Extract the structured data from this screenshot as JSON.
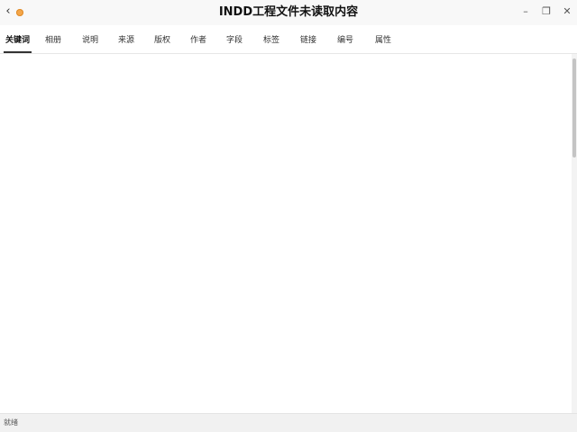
{
  "window": {
    "title": "INDD工程文件未读取内容",
    "back_icon": "chevron-left-icon",
    "app_icon": "app-orange-dot-icon",
    "controls": [
      "minimize-icon",
      "restore-icon",
      "close-icon"
    ]
  },
  "tabs": [
    {
      "label": "关键词"
    },
    {
      "label": "相册"
    },
    {
      "label": "说明"
    },
    {
      "label": "来源"
    },
    {
      "label": "版权"
    },
    {
      "label": "作者"
    },
    {
      "label": "字段"
    },
    {
      "label": "标签"
    },
    {
      "label": "链接"
    },
    {
      "label": "编号"
    },
    {
      "label": "属性"
    }
  ],
  "active_tab": "关键词",
  "status": {
    "text": "就绪"
  },
  "colors": {
    "accent": "#333333",
    "app_icon": "#f4a64a"
  }
}
